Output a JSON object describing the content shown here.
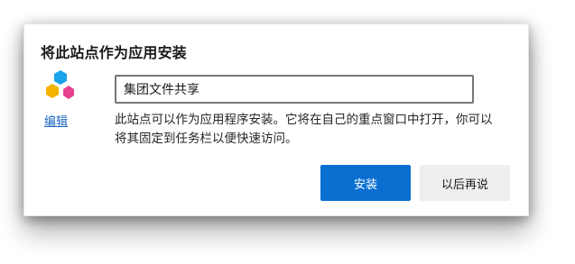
{
  "dialog": {
    "title": "将此站点作为应用安装",
    "edit_label": "编辑",
    "name_value": "集团文件共享",
    "description": "此站点可以作为应用程序安装。它将在自己的重点窗口中打开，你可以将其固定到任务栏以便快速访问。",
    "install_label": "安装",
    "later_label": "以后再说"
  },
  "icons": {
    "app_icon": "app-hexagon-cluster-icon"
  },
  "colors": {
    "primary_button": "#0a6fd1",
    "secondary_button": "#eeeeee",
    "link": "#1a66c2",
    "hex_blue": "#1aa3e8",
    "hex_yellow": "#f5b400",
    "hex_pink": "#e8418f"
  }
}
